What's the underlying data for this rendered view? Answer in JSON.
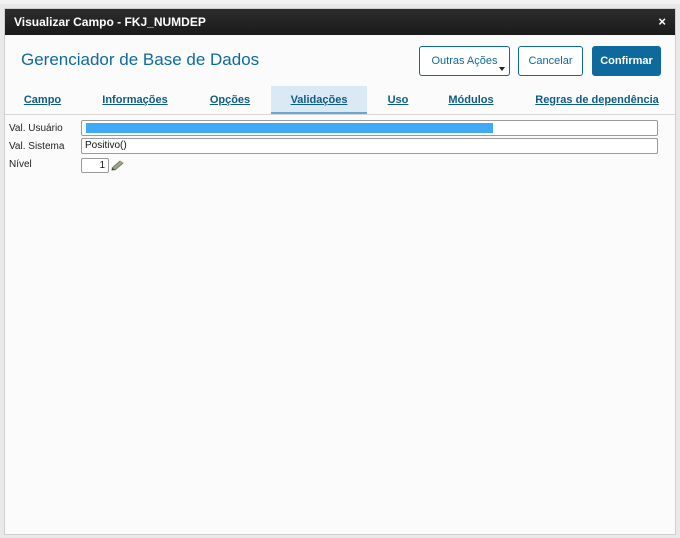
{
  "window": {
    "title": "Visualizar Campo - FKJ_NUMDEP",
    "close_glyph": "×"
  },
  "header": {
    "title": "Gerenciador de Base de Dados"
  },
  "buttons": {
    "more_actions": "Outras Ações",
    "cancel": "Cancelar",
    "confirm": "Confirmar"
  },
  "tabs": [
    {
      "label": "Campo"
    },
    {
      "label": "Informações"
    },
    {
      "label": "Opções"
    },
    {
      "label": "Validações"
    },
    {
      "label": "Uso"
    },
    {
      "label": "Módulos"
    },
    {
      "label": "Regras de dependência"
    }
  ],
  "active_tab": "Validações",
  "form": {
    "val_usuario": {
      "label": "Val. Usuário",
      "value": ""
    },
    "val_sistema": {
      "label": "Val. Sistema",
      "value": "Positivo()"
    },
    "nivel": {
      "label": "Nível",
      "value": "1"
    }
  },
  "colors": {
    "accent": "#0e6a9c",
    "highlight": "#3fa9f5",
    "titlebar": "#1f1f1f"
  },
  "icons": {
    "edit": "pencil-icon",
    "dropdown": "caret-down-icon",
    "close": "close-icon"
  }
}
